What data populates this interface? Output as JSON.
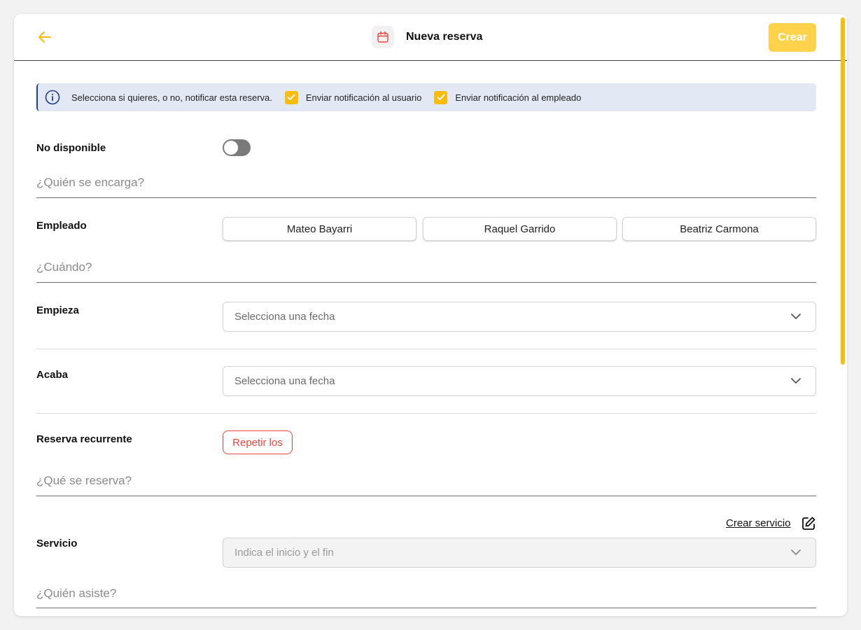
{
  "header": {
    "title": "Nueva reserva",
    "create_label": "Crear",
    "icons": {
      "back": "arrow-left-icon",
      "title": "calendar-icon"
    }
  },
  "notification": {
    "text": "Selecciona si quieres, o no, notificar esta reserva.",
    "notify_user_label": "Enviar notificación al usuario",
    "notify_user_checked": true,
    "notify_employee_label": "Enviar notificación al empleado",
    "notify_employee_checked": true
  },
  "unavailable": {
    "label": "No disponible",
    "enabled": false
  },
  "who": {
    "section_title": "¿Quién se encarga?",
    "employee_label": "Empleado",
    "employees": [
      "Mateo Bayarri",
      "Raquel Garrido",
      "Beatriz Carmona"
    ]
  },
  "when": {
    "section_title": "¿Cuándo?",
    "start_label": "Empieza",
    "start_placeholder": "Selecciona una fecha",
    "end_label": "Acaba",
    "end_placeholder": "Selecciona una fecha",
    "recurring_label": "Reserva recurrente",
    "repeat_label": "Repetir los"
  },
  "what": {
    "section_title": "¿Qué se reserva?",
    "create_service_label": "Crear servicio",
    "service_label": "Servicio",
    "service_placeholder": "Indica el inicio y el fin"
  },
  "attendees": {
    "section_title": "¿Quién asiste?"
  },
  "colors": {
    "accent": "#f8bd0e",
    "button": "#fed24a",
    "danger": "#e8463d",
    "info_bg": "#e2e9f5",
    "info_border": "#1e3e8a"
  }
}
